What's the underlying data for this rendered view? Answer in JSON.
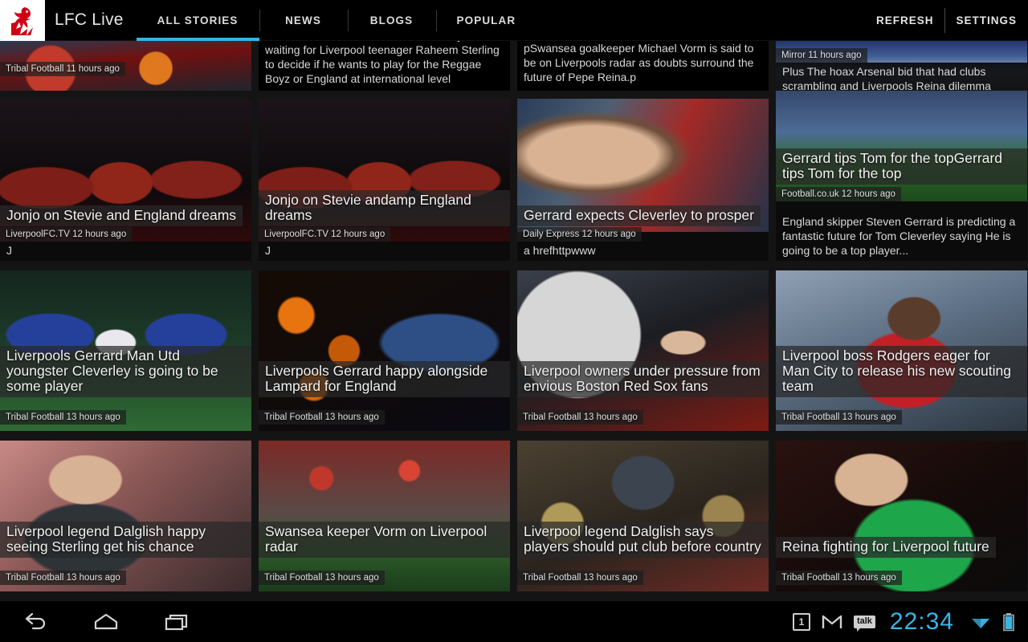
{
  "app": {
    "title": "LFC Live",
    "logo_icon": "liver-bird-logo",
    "accent_color": "#33b5e5"
  },
  "tabs": [
    {
      "label": "ALL STORIES",
      "active": true
    },
    {
      "label": "NEWS",
      "active": false
    },
    {
      "label": "BLOGS",
      "active": false
    },
    {
      "label": "POPULAR",
      "active": false
    }
  ],
  "actions": [
    {
      "label": "REFRESH",
      "name": "refresh-button"
    },
    {
      "label": "SETTINGS",
      "name": "settings-button"
    }
  ],
  "rows": [
    {
      "name": "row-partial-top",
      "cards": [
        {
          "headline": "",
          "source": "Tribal Football 11 hours ago",
          "desc": "",
          "photo": "ph-partial-top"
        },
        {
          "headline": "",
          "source": "",
          "desc": "Jamaica coach Theodore Whitmore says he is waiting for Liverpool teenager Raheem Sterling to decide if he wants to play for the Reggae Boyz or England at international level",
          "photo": "none"
        },
        {
          "headline": "",
          "source": "",
          "desc": "pSwansea goalkeeper Michael Vorm is said to be on Liverpools radar as doubts surround the future of Pepe Reina.p",
          "photo": "none"
        },
        {
          "headline": "Plus The hoax Arsenal bid that had clubs scrambling and Liverpools Reina dilemma",
          "source": "Mirror 11 hours ago",
          "desc": "",
          "photo": "ph-arsenal"
        }
      ]
    },
    {
      "name": "row-2",
      "cards": [
        {
          "headline": "Jonjo on Stevie and England dreams",
          "source": "LiverpoolFC.TV 12 hours ago",
          "desc": "J",
          "photo": "ph-players"
        },
        {
          "headline": "Jonjo on Stevie andamp England dreams",
          "source": "LiverpoolFC.TV 12 hours ago",
          "desc": "J",
          "photo": "ph-players"
        },
        {
          "headline": "Gerrard expects Cleverley to prosper",
          "source": "Daily Express 12 hours ago",
          "desc": "a hrefhttpwww",
          "photo": "ph-face-gerr"
        },
        {
          "headline": "Gerrard tips Tom for the topGerrard tips Tom for the top",
          "source": "Football.co.uk 12 hours ago",
          "desc": "England skipper Steven Gerrard is predicting a fantastic future for Tom Cleverley saying He is going to be a top player...",
          "photo": "ph-goal"
        }
      ]
    },
    {
      "name": "row-3",
      "cards": [
        {
          "headline": "Liverpools Gerrard Man Utd youngster Cleverley is going to be some player",
          "source": "Tribal Football 13 hours ago",
          "desc": "",
          "photo": "ph-blue-pitch"
        },
        {
          "headline": "Liverpools Gerrard happy alongside Lampard for England",
          "source": "Tribal Football 13 hours ago",
          "desc": "",
          "photo": "ph-orange-bokeh"
        },
        {
          "headline": "Liverpool owners under pressure from envious Boston Red Sox fans",
          "source": "Tribal Football 13 hours ago",
          "desc": "",
          "photo": "ph-suits"
        },
        {
          "headline": "Liverpool boss Rodgers eager for Man City to release his new scouting team",
          "source": "Tribal Football 13 hours ago",
          "desc": "",
          "photo": "ph-sterling"
        }
      ]
    },
    {
      "name": "row-4",
      "cards": [
        {
          "headline": "Liverpool legend Dalglish happy seeing Sterling get his chance",
          "source": "Tribal Football 13 hours ago",
          "desc": "",
          "photo": "ph-kenny"
        },
        {
          "headline": "Swansea keeper Vorm on Liverpool radar",
          "source": "Tribal Football 13 hours ago",
          "desc": "",
          "photo": "ph-anfield"
        },
        {
          "headline": "Liverpool legend Dalglish says players should put club before country",
          "source": "Tribal Football 13 hours ago",
          "desc": "",
          "photo": "ph-manager"
        },
        {
          "headline": "Reina fighting for Liverpool future",
          "source": "Tribal Football 13 hours ago",
          "desc": "",
          "photo": "ph-reina"
        }
      ]
    }
  ],
  "system_bar": {
    "back_icon": "back-arrow-icon",
    "home_icon": "home-icon",
    "recents_icon": "recent-apps-icon",
    "calendar_badge": "1",
    "gmail_icon": "gmail-icon",
    "talk_label": "talk",
    "clock": "22:34",
    "wifi_icon": "wifi-icon",
    "battery_icon": "battery-icon"
  }
}
